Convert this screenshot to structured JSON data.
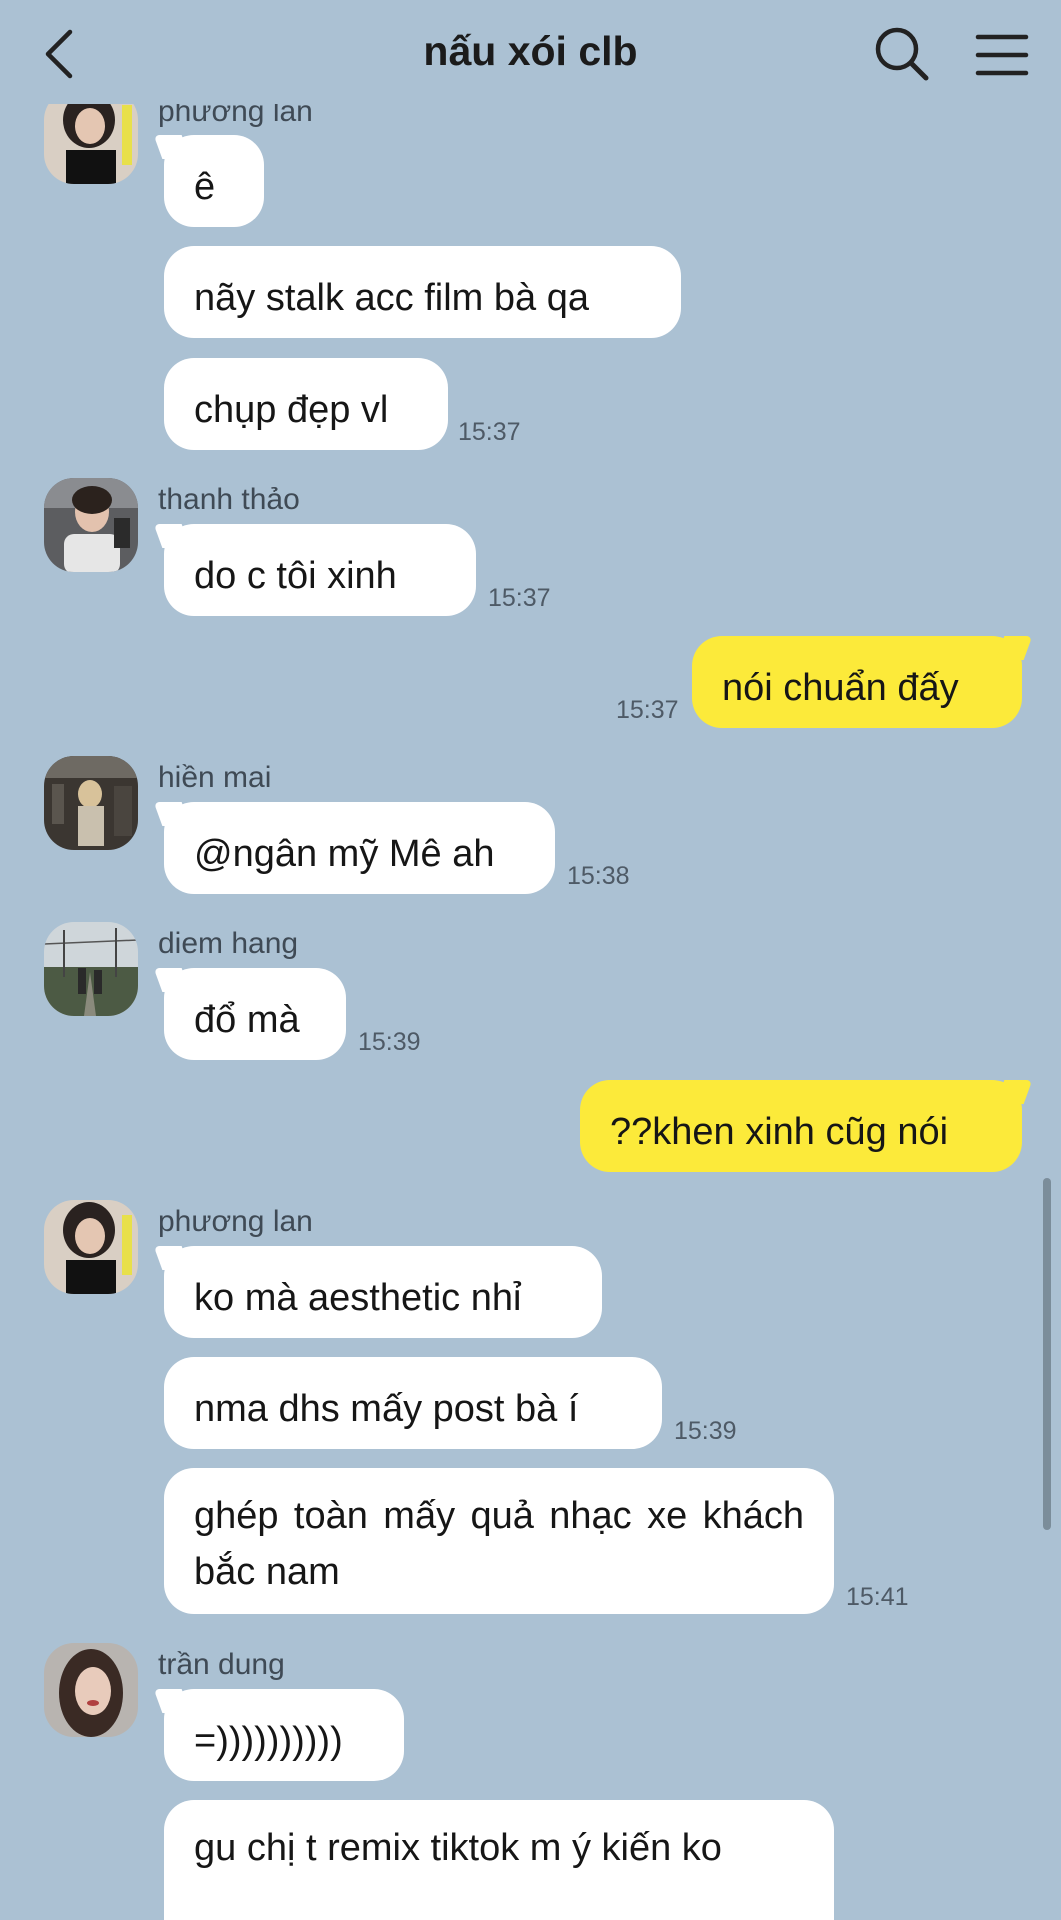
{
  "header": {
    "title": "nấu xói clb"
  },
  "messages": [
    {
      "sender": "phương lan",
      "lines": [
        "ê",
        "nãy stalk acc film bà qa",
        "chụp đẹp vl"
      ],
      "time": "15:37"
    },
    {
      "sender": "thanh thảo",
      "lines": [
        "do c tôi xinh"
      ],
      "time": "15:37"
    },
    {
      "mine": true,
      "lines": [
        "nói chuẩn đấy"
      ],
      "time": "15:37"
    },
    {
      "sender": "hiền mai",
      "lines": [
        "@ngân mỹ Mê ah"
      ],
      "time": "15:38"
    },
    {
      "sender": "diem hang",
      "lines": [
        "đổ mà"
      ],
      "time": "15:39"
    },
    {
      "mine": true,
      "lines": [
        "??khen xinh cũg nói"
      ]
    },
    {
      "sender": "phương lan",
      "lines": [
        "ko mà aesthetic nhỉ",
        "nma dhs mấy post bà í",
        "ghép toàn mấy quả nhạc xe khách bắc nam"
      ],
      "times": [
        "15:39",
        "15:41"
      ]
    },
    {
      "sender": "trần dung",
      "lines": [
        "=))))))))))",
        "gu chị t remix tiktok m ý kiến ko"
      ]
    }
  ],
  "icons": {
    "back": "chevron-left-icon",
    "search": "search-icon",
    "menu": "hamburger-menu-icon"
  },
  "colors": {
    "background": "#abc1d3",
    "mine_bubble": "#fcea3a",
    "other_bubble": "#ffffff"
  }
}
